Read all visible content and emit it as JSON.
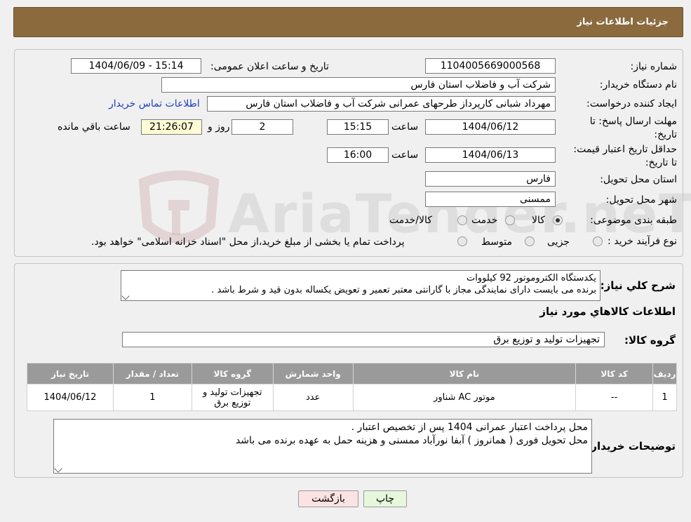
{
  "header": {
    "title": "جزئیات اطلاعات نیاز"
  },
  "info": {
    "need_number_label": "شماره نیاز:",
    "need_number": "1104005669000568",
    "announce_label": "تاریخ و ساعت اعلان عمومی:",
    "announce_value": "1404/06/09 - 15:14",
    "buyer_org_label": "نام دستگاه خریدار:",
    "buyer_org": "شرکت آب و فاضلاب استان فارس",
    "creator_label": "ایجاد کننده درخواست:",
    "creator": "مهرداد شبانی کارپرداز طرحهای عمرانی  شرکت آب و فاضلاب استان فارس",
    "contact_link": "اطلاعات تماس خریدار",
    "deadline_label": "مهلت ارسال پاسخ: تا تاریخ:",
    "deadline_date": "1404/06/12",
    "time_label": "ساعت",
    "deadline_time": "15:15",
    "days": "2",
    "days_label": "روز و",
    "remaining": "21:26:07",
    "remaining_label": "ساعت باقي مانده",
    "validity_label": "حداقل تاریخ اعتبار قیمت: تا تاریخ:",
    "validity_date": "1404/06/13",
    "validity_time": "16:00",
    "province_label": "استان محل تحویل:",
    "province": "فارس",
    "city_label": "شهر محل تحویل:",
    "city": "ممسنی",
    "category_label": "طبقه بندی موضوعی:",
    "cat_goods": "کالا",
    "cat_service": "خدمت",
    "cat_both": "کالا/خدمت",
    "process_label": "نوع فرآیند خرید :",
    "proc_partial": "جزیی",
    "proc_medium": "متوسط",
    "proc_note": "پرداخت تمام یا بخشی از مبلغ خرید،از محل \"اسناد خزانه اسلامی\" خواهد بود."
  },
  "watermark": "AriaTender.neT",
  "summary": {
    "label": "شرح کلي نياز:",
    "line1": "یکدستگاه الکتروموتور 92 کیلووات",
    "line2": "برنده می بایست دارای نمایندگی مجاز با گارانتی معتبر تعمیر و تعویض یکساله بدون قید و شرط باشد ."
  },
  "goods_section_title": "اطلاعات کالاهاي مورد نياز",
  "goods_group": {
    "label": "گروه کالا:",
    "value": "تجهیزات تولید و توزیع برق"
  },
  "table": {
    "headers": [
      "رديف",
      "کد کالا",
      "نام کالا",
      "واحد شمارش",
      "گروه کالا",
      "تعداد / مقدار",
      "تاريخ نياز"
    ],
    "rows": [
      [
        "1",
        "--",
        "موتور AC شناور",
        "عدد",
        "تجهیزات تولید و توزیع برق",
        "1",
        "1404/06/12"
      ]
    ]
  },
  "buyer_notes": {
    "label": "توضيحات خريدار:",
    "line1": "محل پرداخت اعتبار عمرانی 1404 پس از تخصیص اعتبار .",
    "line2": "محل تحویل فوری ( همانروز ) آبفا نورآباد ممسنی و هزینه حمل به عهده برنده می باشد"
  },
  "buttons": {
    "print": "چاپ",
    "back": "بازگشت"
  }
}
